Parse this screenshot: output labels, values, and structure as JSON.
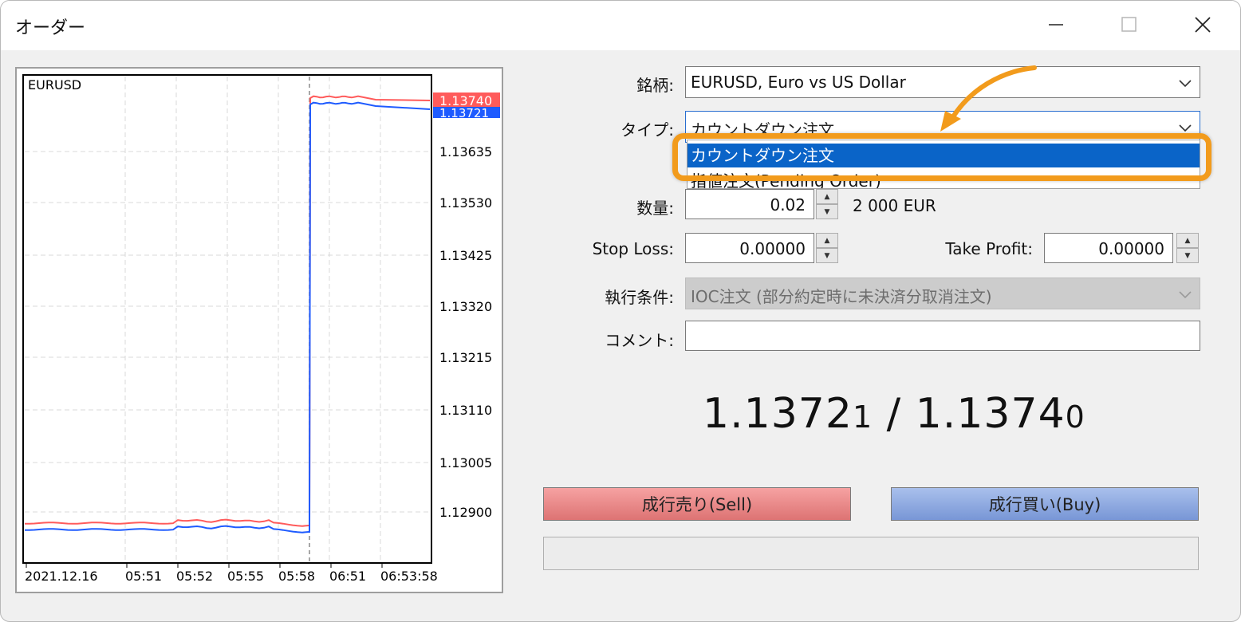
{
  "window": {
    "title": "オーダー"
  },
  "chart": {
    "symbol": "EURUSD",
    "ask_label": "1.13740",
    "bid_label": "1.13721",
    "price_ticks": [
      "1.13635",
      "1.13530",
      "1.13425",
      "1.13320",
      "1.13215",
      "1.13110",
      "1.13005",
      "1.12900"
    ],
    "time_ticks": [
      "2021.12.16",
      "05:51",
      "05:52",
      "05:55",
      "05:58",
      "06:51",
      "06:53:58"
    ],
    "colors": {
      "ask": "#ff5b5b",
      "bid": "#1e5bff",
      "grid": "#d9d9d9"
    }
  },
  "form": {
    "symbol_label": "銘柄:",
    "symbol_value": "EURUSD, Euro vs US Dollar",
    "type_label": "タイプ:",
    "type_value": "カウントダウン注文",
    "type_options": [
      "カウントダウン注文",
      "指値注文(Pending Order)"
    ],
    "volume_label": "数量:",
    "volume_value": "0.02",
    "volume_unit": "2 000 EUR",
    "sl_label": "Stop Loss:",
    "sl_value": "0.00000",
    "tp_label": "Take Profit:",
    "tp_value": "0.00000",
    "exec_label": "執行条件:",
    "exec_value": "IOC注文 (部分約定時に未決済分取消注文)",
    "comment_label": "コメント:",
    "comment_value": ""
  },
  "quote": {
    "bid_main": "1.1372",
    "bid_small": "1",
    "sep": " / ",
    "ask_main": "1.1374",
    "ask_small": "0"
  },
  "buttons": {
    "sell": "成行売り(Sell)",
    "buy": "成行買い(Buy)"
  }
}
